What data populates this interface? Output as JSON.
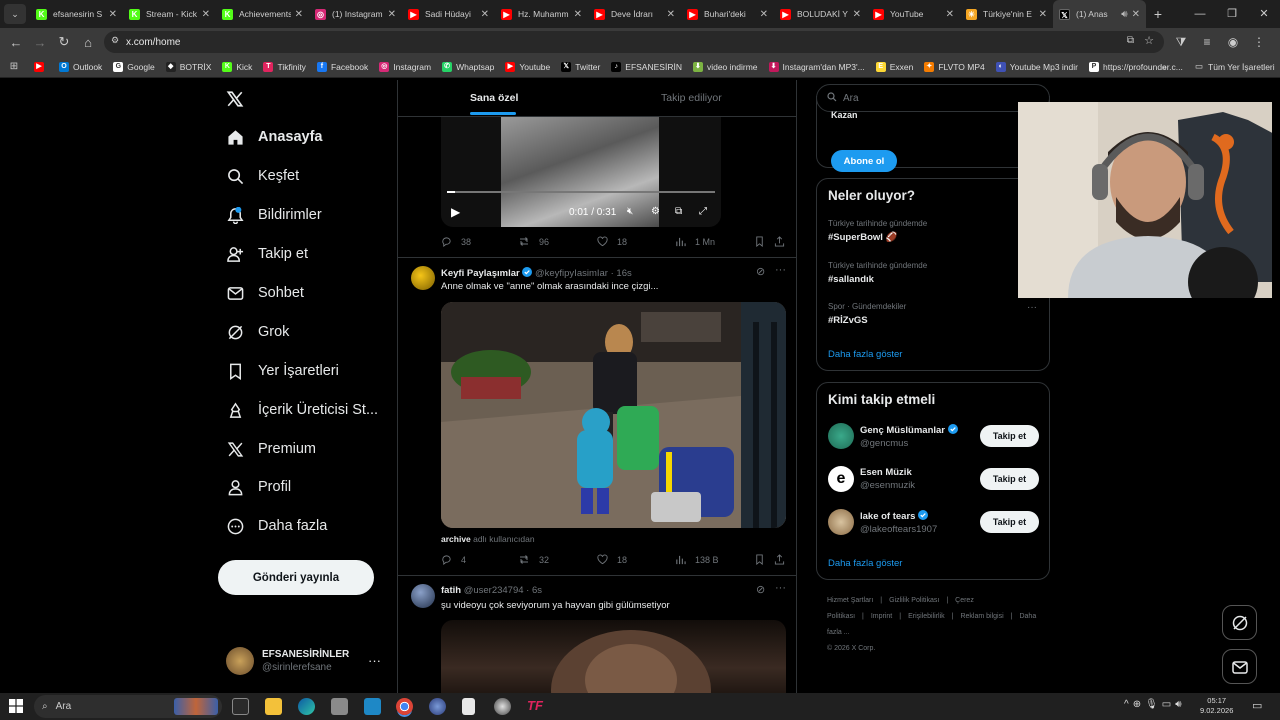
{
  "browser": {
    "tabs": [
      {
        "title": "efsanesirin S",
        "color": "#53fc18",
        "glyph": "K"
      },
      {
        "title": "Stream - Kick",
        "color": "#53fc18",
        "glyph": "K"
      },
      {
        "title": "Achievements",
        "color": "#53fc18",
        "glyph": "K"
      },
      {
        "title": "(1) Instagram",
        "color": "#d62976",
        "glyph": "◎"
      },
      {
        "title": "Sadi Hüdayi",
        "color": "#ff0000",
        "glyph": "▶"
      },
      {
        "title": "Hz. Muhamm",
        "color": "#ff0000",
        "glyph": "▶"
      },
      {
        "title": "Deve İdrarı",
        "color": "#ff0000",
        "glyph": "▶"
      },
      {
        "title": "Buhari'deki",
        "color": "#ff0000",
        "glyph": "▶"
      },
      {
        "title": "BOLUDAKİ Y",
        "color": "#ff0000",
        "glyph": "▶"
      },
      {
        "title": "YouTube",
        "color": "#ff0000",
        "glyph": "▶"
      },
      {
        "title": "Türkiye'nin E",
        "color": "#f5a623",
        "glyph": "☀"
      },
      {
        "title": "(1) Anas",
        "color": "#000000",
        "glyph": "𝕏"
      }
    ],
    "url": "x.com/home",
    "bookmarks": [
      {
        "label": "",
        "color": "#ff0000",
        "glyph": "▶"
      },
      {
        "label": "Outlook",
        "color": "#0078d4",
        "glyph": "O"
      },
      {
        "label": "Google",
        "color": "#ffffff",
        "glyph": "G"
      },
      {
        "label": "BOTRİX",
        "color": "#222222",
        "glyph": "◆"
      },
      {
        "label": "Kick",
        "color": "#53fc18",
        "glyph": "K"
      },
      {
        "label": "Tikfinity",
        "color": "#e0245e",
        "glyph": "T"
      },
      {
        "label": "Facebook",
        "color": "#1877f2",
        "glyph": "f"
      },
      {
        "label": "Instagram",
        "color": "#d62976",
        "glyph": "◎"
      },
      {
        "label": "Whaptsap",
        "color": "#25d366",
        "glyph": "✆"
      },
      {
        "label": "Youtube",
        "color": "#ff0000",
        "glyph": "▶"
      },
      {
        "label": "Twitter",
        "color": "#000000",
        "glyph": "𝕏"
      },
      {
        "label": "EFSANESİRİN",
        "color": "#000000",
        "glyph": "♪"
      },
      {
        "label": "video indirme",
        "color": "#7cb342",
        "glyph": "⬇"
      },
      {
        "label": "Instagram'dan MP3'...",
        "color": "#c2185b",
        "glyph": "⬇"
      },
      {
        "label": "Exxen",
        "color": "#fdd835",
        "glyph": "E"
      },
      {
        "label": "FLVTO MP4",
        "color": "#f57c00",
        "glyph": "✦"
      },
      {
        "label": "Youtube Mp3 indir",
        "color": "#3f51b5",
        "glyph": "◐"
      },
      {
        "label": "https://profounder.c...",
        "color": "#ffffff",
        "glyph": "P"
      }
    ],
    "bookmarks_more": "»",
    "all_bookmarks": "Tüm Yer İşaretleri"
  },
  "nav": {
    "items": [
      {
        "label": "Anasayfa",
        "icon": "home-icon"
      },
      {
        "label": "Keşfet",
        "icon": "search-icon"
      },
      {
        "label": "Bildirimler",
        "icon": "bell-icon"
      },
      {
        "label": "Takip et",
        "icon": "follow-icon"
      },
      {
        "label": "Sohbet",
        "icon": "mail-icon"
      },
      {
        "label": "Grok",
        "icon": "grok-icon"
      },
      {
        "label": "Yer İşaretleri",
        "icon": "bookmark-icon"
      },
      {
        "label": "İçerik Üreticisi St...",
        "icon": "creator-icon"
      },
      {
        "label": "Premium",
        "icon": "x-icon"
      },
      {
        "label": "Profil",
        "icon": "profile-icon"
      },
      {
        "label": "Daha fazla",
        "icon": "more-icon"
      }
    ],
    "post_button": "Gönderi yayınla",
    "account": {
      "name": "EFSANESİRİNLER",
      "handle": "@sirinlerefsane"
    }
  },
  "feed": {
    "tabs": [
      "Sana özel",
      "Takip ediliyor"
    ],
    "tweet1": {
      "video_time": "0:01 / 0:31",
      "stats": {
        "replies": "38",
        "reposts": "96",
        "likes": "18",
        "views": "1 Mn"
      }
    },
    "tweet2": {
      "name": "Keyfi Paylaşımlar",
      "handle": "@keyfipyIasimIar",
      "time": "· 16s",
      "text": "Anne olmak ve \"anne\" olmak arasındaki ince çizgi...",
      "caption_user": "archive",
      "caption_rest": "adlı kullanıcıdan",
      "stats": {
        "replies": "4",
        "reposts": "32",
        "likes": "18",
        "views": "138 B"
      }
    },
    "tweet3": {
      "name": "fatih",
      "handle": "@user234794",
      "time": "· 6s",
      "text": "şu videoyu çok seviyorum ya hayvan gibi gülümsetiyor"
    }
  },
  "sidebar": {
    "search_placeholder": "Ara",
    "premium_cut": "Kazan",
    "subscribe": "Abone ol",
    "trends_title": "Neler oluyor?",
    "trends": [
      {
        "context": "Türkiye tarihinde gündemde",
        "name": "#SuperBowl 🏈"
      },
      {
        "context": "Türkiye tarihinde gündemde",
        "name": "#sallandık"
      },
      {
        "context": "Spor · Gündemdekiler",
        "name": "#RİZvGS"
      }
    ],
    "show_more": "Daha fazla göster",
    "who_title": "Kimi takip etmeli",
    "who": [
      {
        "name": "Genç Müslümanlar",
        "handle": "@gencmus",
        "verified": true
      },
      {
        "name": "Esen Müzik",
        "handle": "@esenmuzik",
        "verified": false
      },
      {
        "name": "lake of tears",
        "handle": "@lakeoftears1907",
        "verified": true
      }
    ],
    "follow_label": "Takip et",
    "footer": [
      "Hizmet Şartları",
      "|",
      "Gizlilik Politikası",
      "|",
      "Çerez Politikası",
      "|",
      "Imprint",
      "|",
      "Erişilebilirlik",
      "|",
      "Reklam bilgisi",
      "|",
      "Daha fazla ...",
      "© 2026 X Corp."
    ]
  },
  "taskbar": {
    "search": "Ara",
    "time": "05:17",
    "date": "9.02.2026"
  }
}
